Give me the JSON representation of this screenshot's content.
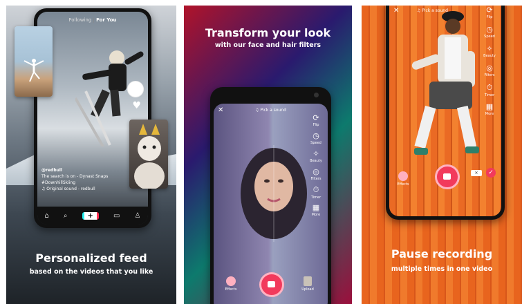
{
  "panels": [
    {
      "caption_title": "Personalized feed",
      "caption_sub": "based on the videos that you like",
      "tabs": [
        "Following",
        "For You"
      ],
      "username": "@redbull",
      "description": "The search is on - Dynast Snaps #DownhillSkiing",
      "sound": "♫ Original sound - redbull",
      "nav_plus": "+"
    },
    {
      "caption_title": "Transform your look",
      "caption_sub": "with our face and hair filters",
      "pick_sound": "♫ Pick a sound",
      "side_labels": [
        "Flip",
        "Speed",
        "Beauty",
        "Filters",
        "Timer",
        "More"
      ],
      "bottom_left": "Effects",
      "bottom_right": "Upload"
    },
    {
      "caption_title": "Pause recording",
      "caption_sub": "multiple times in one video",
      "pick_sound": "♫ Pick a sound",
      "side_labels": [
        "Flip",
        "Speed",
        "Beauty",
        "Filters",
        "Timer",
        "More"
      ],
      "bottom_left": "Effects"
    }
  ],
  "colors": {
    "record": "#f23a5c",
    "accent_check": "#f23a5c"
  }
}
